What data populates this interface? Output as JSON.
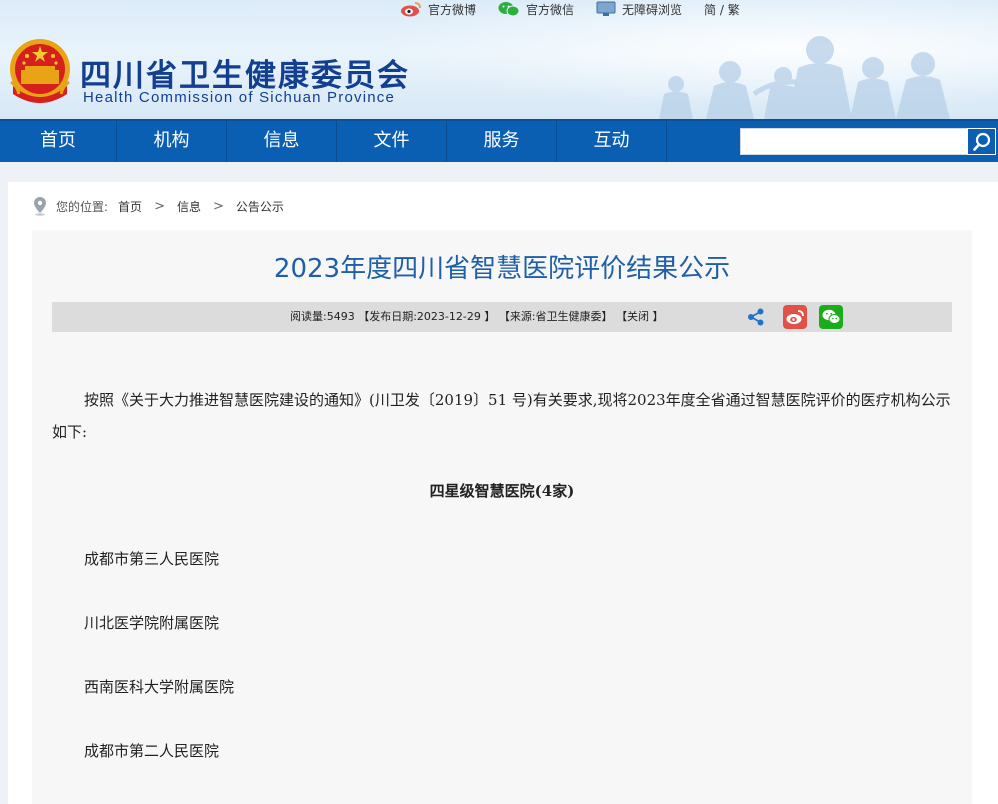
{
  "topbar": {
    "weibo": "官方微博",
    "wechat": "官方微信",
    "accessible": "无障碍浏览",
    "lang": "简 / 繁"
  },
  "site": {
    "name_cn": "四川省卫生健康委员会",
    "name_en": "Health Commission of Sichuan Province"
  },
  "nav": {
    "items": [
      "首页",
      "机构",
      "信息",
      "文件",
      "服务",
      "互动"
    ],
    "search_placeholder": ""
  },
  "breadcrumb": {
    "label": "您的位置:",
    "items": [
      "首页",
      "信息",
      "公告公示"
    ],
    "separator": ">"
  },
  "article": {
    "title": "2023年度四川省智慧医院评价结果公示",
    "meta": {
      "reads": "阅读量:5493",
      "date": "【发布日期:2023-12-29 】",
      "source": "【来源:省卫生健康委】",
      "close": "【关闭 】"
    },
    "intro": "按照《关于大力推进智慧医院建设的通知》(川卫发〔2019〕51 号)有关要求,现将2023年度全省通过智慧医院评价的医疗机构公示如下:",
    "section_heading": "四星级智慧医院(4家)",
    "hospitals": [
      "成都市第三人民医院",
      "川北医学院附属医院",
      "西南医科大学附属医院",
      "成都市第二人民医院"
    ]
  },
  "colors": {
    "nav_bg": "#0b5fb3",
    "title": "#1f5fa8",
    "site_name": "#123f8f",
    "weibo": "#e2504a",
    "wechat": "#1aad19"
  },
  "icons": [
    "weibo-icon",
    "wechat-icon",
    "monitor-icon",
    "national-emblem",
    "search-icon",
    "location-pin-icon",
    "share-icon"
  ]
}
